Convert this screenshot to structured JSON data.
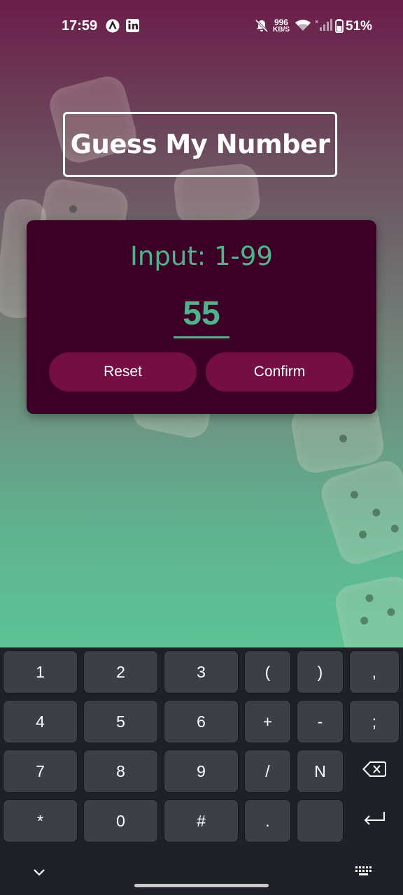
{
  "status_bar": {
    "time": "17:59",
    "net_speed_value": "996",
    "net_speed_unit": "KB/S",
    "battery_percent": "51%",
    "icons": [
      "app-a-icon",
      "linkedin-icon",
      "bell-off-icon",
      "wifi-icon",
      "signal-icon",
      "battery-icon"
    ]
  },
  "title": "Guess My Number",
  "card": {
    "label": "Input: 1-99",
    "input_value": "55",
    "reset_label": "Reset",
    "confirm_label": "Confirm"
  },
  "colors": {
    "accent": "#4fb48c",
    "card_bg": "#3c0026",
    "button_bg": "#740e43",
    "key_bg": "#3c3f47",
    "keyboard_bg": "#1e2128"
  },
  "keyboard": {
    "rows": [
      [
        "1",
        "2",
        "3",
        "(",
        ")",
        ","
      ],
      [
        "4",
        "5",
        "6",
        "+",
        "-",
        ";"
      ],
      [
        "7",
        "8",
        "9",
        "/",
        "N"
      ],
      [
        "*",
        "0",
        "#",
        "."
      ]
    ],
    "backspace_icon": "backspace-icon",
    "enter_icon": "enter-icon",
    "collapse_icon": "chevron-down-icon",
    "switch_icon": "keyboard-icon"
  }
}
